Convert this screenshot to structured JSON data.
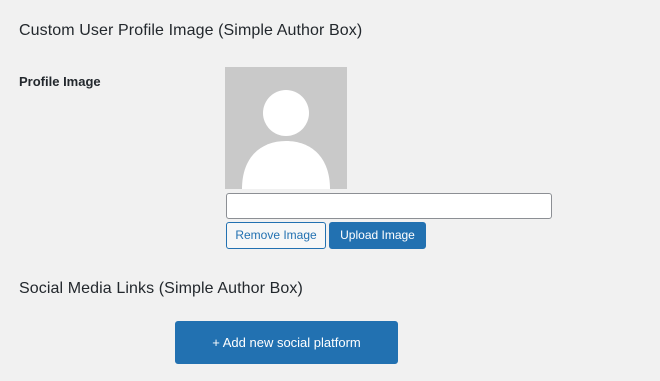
{
  "profile_section": {
    "title": "Custom User Profile Image (Simple Author Box)",
    "field_label": "Profile Image",
    "avatar_icon": "default-user-silhouette",
    "image_url_value": "",
    "remove_button_label": "Remove Image",
    "upload_button_label": "Upload Image"
  },
  "social_section": {
    "title": "Social Media Links (Simple Author Box)",
    "add_button_label": "+ Add new social platform"
  },
  "colors": {
    "background": "#f1f1f1",
    "primary": "#2271b1",
    "avatar_bg": "#c9c9c9",
    "avatar_fg": "#ffffff",
    "text": "#23282d"
  }
}
